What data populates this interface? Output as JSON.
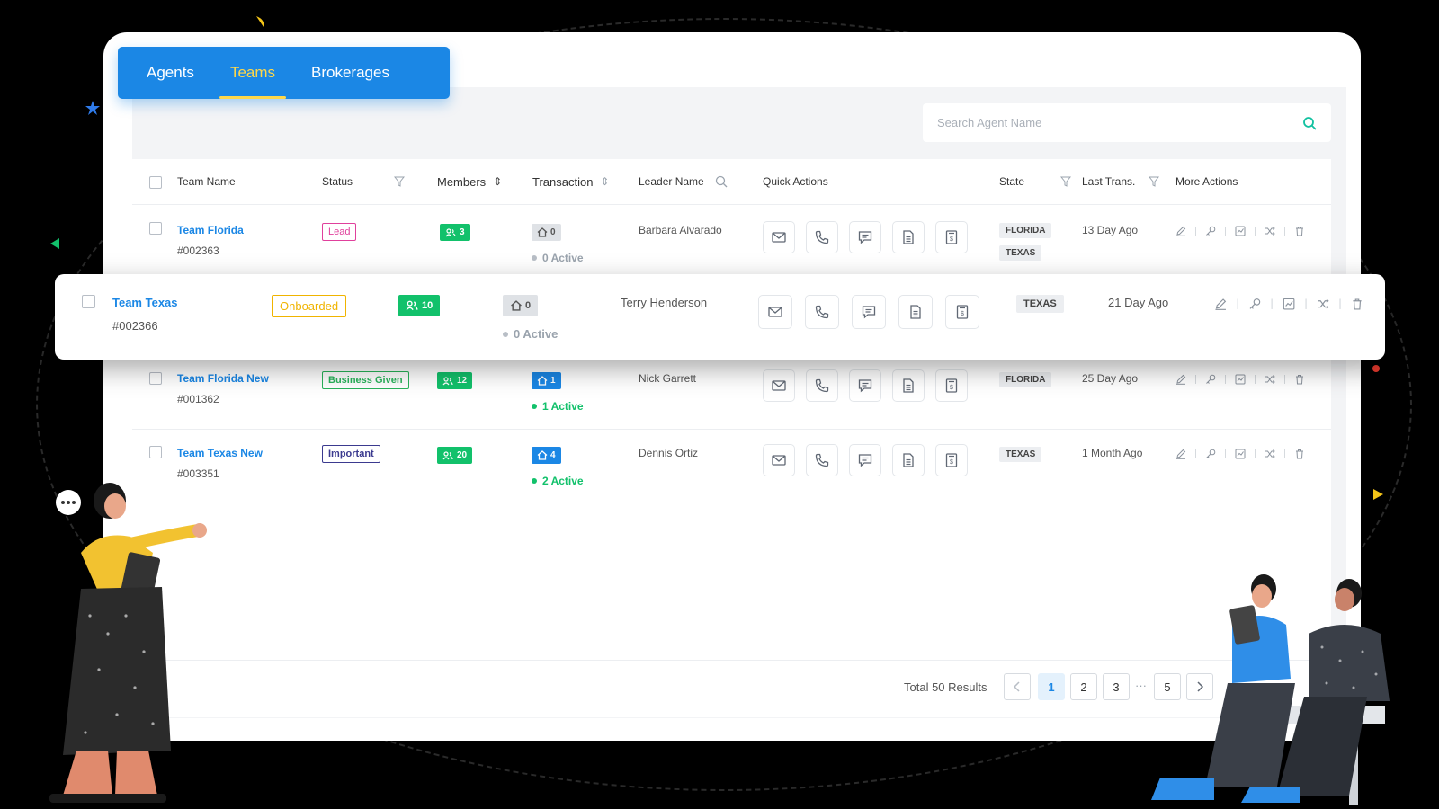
{
  "tabs": [
    {
      "label": "Agents",
      "active": false
    },
    {
      "label": "Teams",
      "active": true
    },
    {
      "label": "Brokerages",
      "active": false
    }
  ],
  "search": {
    "placeholder": "Search Agent Name"
  },
  "columns": {
    "team_name": "Team Name",
    "status": "Status",
    "members": "Members",
    "transaction": "Transaction",
    "leader_name": "Leader Name",
    "quick_actions": "Quick Actions",
    "state": "State",
    "last_trans": "Last Trans.",
    "more_actions": "More Actions"
  },
  "rows": [
    {
      "name": "Team Florida",
      "id": "#002363",
      "status": "Lead",
      "members": "3",
      "transactions": "0",
      "active": "0 Active",
      "leader": "Barbara Alvarado",
      "states": [
        "FLORIDA",
        "TEXAS"
      ],
      "last": "13 Day Ago"
    },
    {
      "name": "Team Texas",
      "id": "#002366",
      "status": "Onboarded",
      "members": "10",
      "transactions": "0",
      "active": "0 Active",
      "leader": "Terry Henderson",
      "states": [
        "TEXAS"
      ],
      "last": "21 Day Ago"
    },
    {
      "name": "Team Florida New",
      "id": "#001362",
      "status": "Business Given",
      "members": "12",
      "transactions": "1",
      "active": "1 Active",
      "leader": "Nick Garrett",
      "states": [
        "FLORIDA"
      ],
      "last": "25 Day Ago"
    },
    {
      "name": "Team Texas New",
      "id": "#003351",
      "status": "Important",
      "members": "20",
      "transactions": "4",
      "active": "2 Active",
      "leader": "Dennis Ortiz",
      "states": [
        "TEXAS"
      ],
      "last": "1 Month Ago"
    }
  ],
  "quick_action_icons": [
    "mail-icon",
    "phone-icon",
    "chat-icon",
    "document-icon",
    "invoice-icon"
  ],
  "more_action_icons": [
    "edit-icon",
    "key-icon",
    "chart-icon",
    "shuffle-icon",
    "trash-icon"
  ],
  "pagination": {
    "total": "Total 50 Results",
    "pages": [
      "1",
      "2",
      "3",
      "5"
    ],
    "ellipsis": "···",
    "current": "1"
  },
  "colors": {
    "primary": "#1b87e5",
    "tab_active": "#ffd84a",
    "members_badge": "#12c16b",
    "lead": "#e0409c",
    "onboarded": "#f0b400",
    "business_given": "#29b35a",
    "important": "#3b3a8f"
  }
}
